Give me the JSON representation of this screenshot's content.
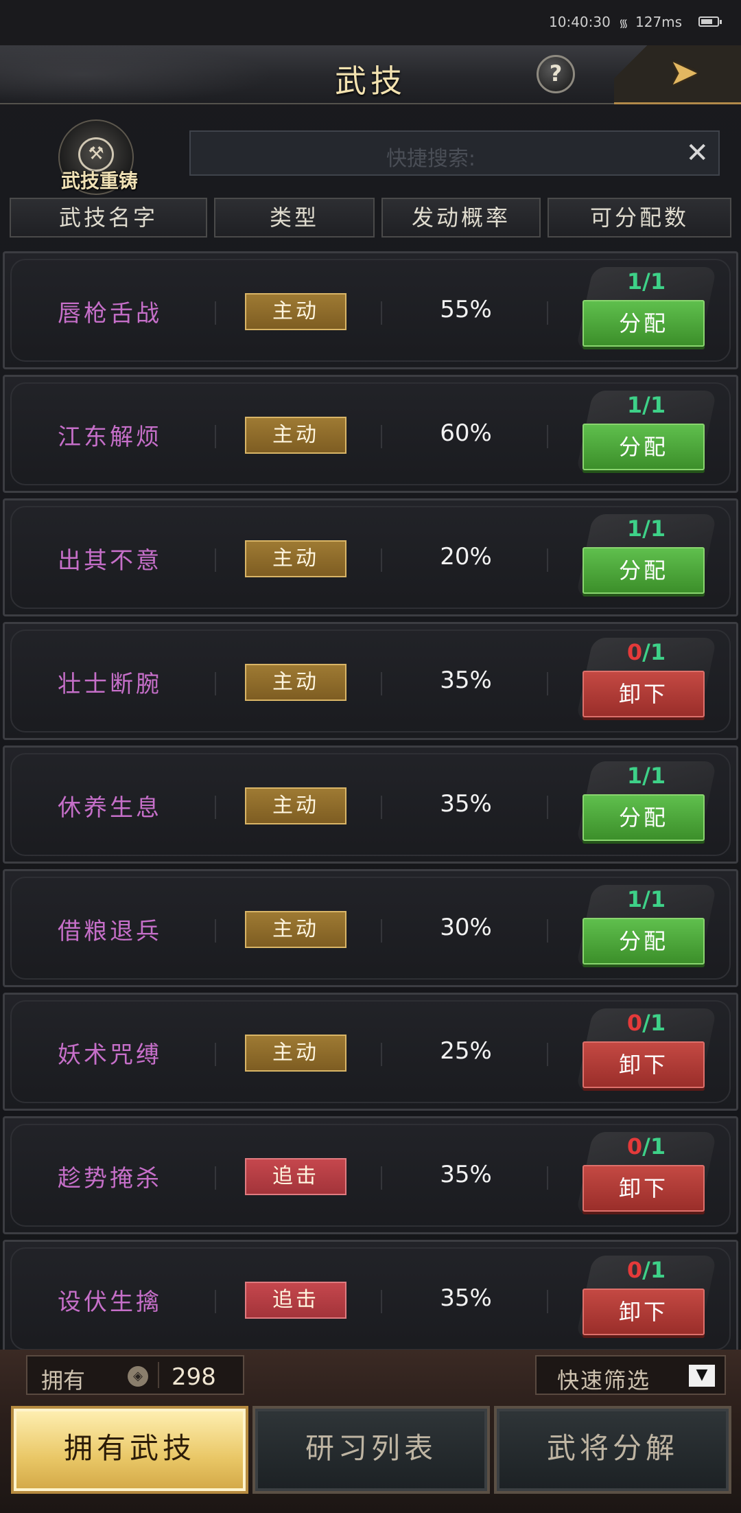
{
  "status": {
    "time": "10:40:30",
    "ping": "127ms"
  },
  "header": {
    "title": "武技",
    "help": "?"
  },
  "toolbar": {
    "recast_label": "武技重铸",
    "search_placeholder": "快捷搜索:",
    "clear": "✕"
  },
  "columns": [
    "武技名字",
    "类型",
    "发动概率",
    "可分配数"
  ],
  "skills": [
    {
      "name": "唇枪舌战",
      "type": "主动",
      "type_kind": "active",
      "rate": "55%",
      "used": "1",
      "total": "1",
      "action": "分配",
      "action_kind": "assign"
    },
    {
      "name": "江东解烦",
      "type": "主动",
      "type_kind": "active",
      "rate": "60%",
      "used": "1",
      "total": "1",
      "action": "分配",
      "action_kind": "assign"
    },
    {
      "name": "出其不意",
      "type": "主动",
      "type_kind": "active",
      "rate": "20%",
      "used": "1",
      "total": "1",
      "action": "分配",
      "action_kind": "assign"
    },
    {
      "name": "壮士断腕",
      "type": "主动",
      "type_kind": "active",
      "rate": "35%",
      "used": "0",
      "total": "1",
      "action": "卸下",
      "action_kind": "unload"
    },
    {
      "name": "休养生息",
      "type": "主动",
      "type_kind": "active",
      "rate": "35%",
      "used": "1",
      "total": "1",
      "action": "分配",
      "action_kind": "assign"
    },
    {
      "name": "借粮退兵",
      "type": "主动",
      "type_kind": "active",
      "rate": "30%",
      "used": "1",
      "total": "1",
      "action": "分配",
      "action_kind": "assign"
    },
    {
      "name": "妖术咒缚",
      "type": "主动",
      "type_kind": "active",
      "rate": "25%",
      "used": "0",
      "total": "1",
      "action": "卸下",
      "action_kind": "unload"
    },
    {
      "name": "趁势掩杀",
      "type": "追击",
      "type_kind": "chase",
      "rate": "35%",
      "used": "0",
      "total": "1",
      "action": "卸下",
      "action_kind": "unload"
    },
    {
      "name": "设伏生擒",
      "type": "追击",
      "type_kind": "chase",
      "rate": "35%",
      "used": "0",
      "total": "1",
      "action": "卸下",
      "action_kind": "unload"
    }
  ],
  "footer": {
    "owned_label": "拥有",
    "owned_value": "298",
    "filter_label": "快速筛选",
    "tabs": [
      "拥有武技",
      "研习列表",
      "武将分解"
    ]
  },
  "colors": {
    "skill_name": "#c66fc9",
    "assign_green": "#4ea83b",
    "unload_red": "#b53d38",
    "count_green": "#3ed188",
    "count_red": "#e43a3a"
  }
}
